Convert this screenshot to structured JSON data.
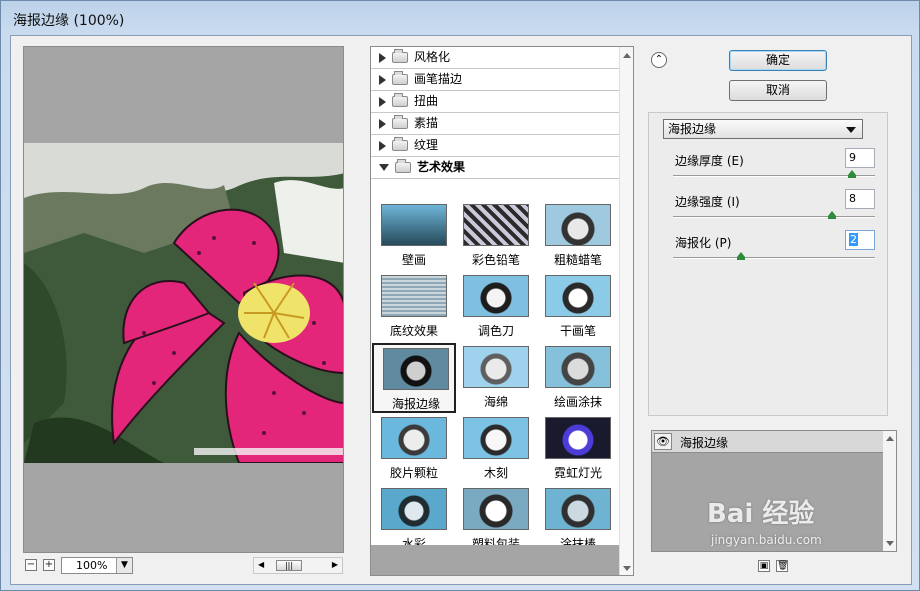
{
  "window": {
    "title": "海报边缘 (100%)"
  },
  "preview": {
    "zoom": "100%",
    "zoom_out": "−",
    "zoom_in": "+"
  },
  "filters": {
    "categories": [
      {
        "label": "风格化",
        "open": false
      },
      {
        "label": "画笔描边",
        "open": false
      },
      {
        "label": "扭曲",
        "open": false
      },
      {
        "label": "素描",
        "open": false
      },
      {
        "label": "纹理",
        "open": false
      },
      {
        "label": "艺术效果",
        "open": true
      }
    ],
    "thumbnails": [
      "壁画",
      "彩色铅笔",
      "粗糙蜡笔",
      "底纹效果",
      "调色刀",
      "干画笔",
      "海报边缘",
      "海绵",
      "绘画涂抹",
      "胶片颗粒",
      "木刻",
      "霓虹灯光",
      "水彩",
      "塑料包装",
      "涂抹棒"
    ],
    "selected": "海报边缘"
  },
  "buttons": {
    "ok": "确定",
    "cancel": "取消"
  },
  "options": {
    "filter_select": "海报边缘",
    "params": [
      {
        "label": "边缘厚度 (E)",
        "value": "9",
        "slider": 0.9
      },
      {
        "label": "边缘强度 (I)",
        "value": "8",
        "slider": 0.8
      },
      {
        "label": "海报化 (P)",
        "value": "2",
        "slider": 0.33
      }
    ]
  },
  "layers": {
    "items": [
      "海报边缘"
    ]
  },
  "watermark": {
    "logo": "Bai 经验",
    "site": "jingyan.baidu.com"
  }
}
